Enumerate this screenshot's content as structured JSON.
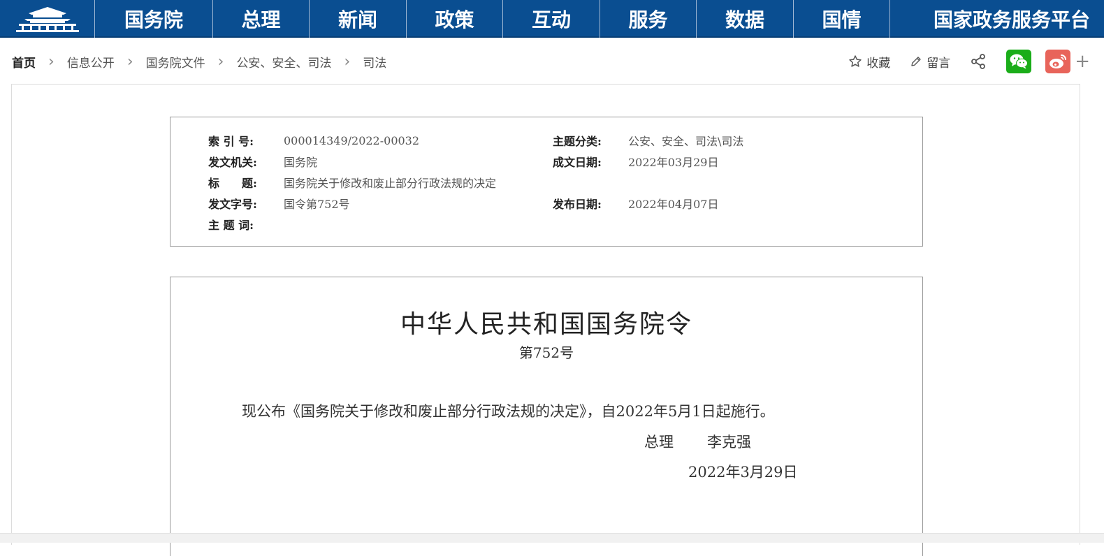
{
  "nav": {
    "logo_icon": "gate-tower-logo-icon",
    "items": [
      {
        "label": "国务院"
      },
      {
        "label": "总理"
      },
      {
        "label": "新闻"
      },
      {
        "label": "政策"
      },
      {
        "label": "互动"
      },
      {
        "label": "服务"
      },
      {
        "label": "数据"
      },
      {
        "label": "国情"
      },
      {
        "label": "国家政务服务平台"
      }
    ]
  },
  "breadcrumb": {
    "items": [
      {
        "label": "首页"
      },
      {
        "label": "信息公开"
      },
      {
        "label": "国务院文件"
      },
      {
        "label": "公安、安全、司法"
      },
      {
        "label": "司法"
      }
    ]
  },
  "tools": {
    "favorite_label": "收藏",
    "favorite_icon": "star-icon",
    "message_label": "留言",
    "message_icon": "pencil-icon",
    "share_icon": "share-icon",
    "wechat_icon": "wechat-icon",
    "weibo_icon": "weibo-icon",
    "more_label": "+",
    "wechat_color": "#1aad19",
    "weibo_color": "#e8645a"
  },
  "info": {
    "index_label": "索 引 号:",
    "index_value": "000014349/2022-00032",
    "category_label": "主题分类:",
    "category_value": "公安、安全、司法\\司法",
    "issuer_label": "发文机关:",
    "issuer_value": "国务院",
    "written_date_label": "成文日期:",
    "written_date_value": "2022年03月29日",
    "title_label": "标　　题:",
    "title_value": "国务院关于修改和废止部分行政法规的决定",
    "doc_no_label": "发文字号:",
    "doc_no_value": "国令第752号",
    "publish_date_label": "发布日期:",
    "publish_date_value": "2022年04月07日",
    "keywords_label": "主 题 词:",
    "keywords_value": ""
  },
  "document": {
    "title": "中华人民共和国国务院令",
    "number": "第752号",
    "body": "现公布《国务院关于修改和废止部分行政法规的决定》，自2022年5月1日起施行。",
    "signer_title": "总理",
    "signer_name": "李克强",
    "date": "2022年3月29日"
  },
  "colors": {
    "nav_bg": "#0a4e91",
    "nav_text": "#ffffff"
  }
}
